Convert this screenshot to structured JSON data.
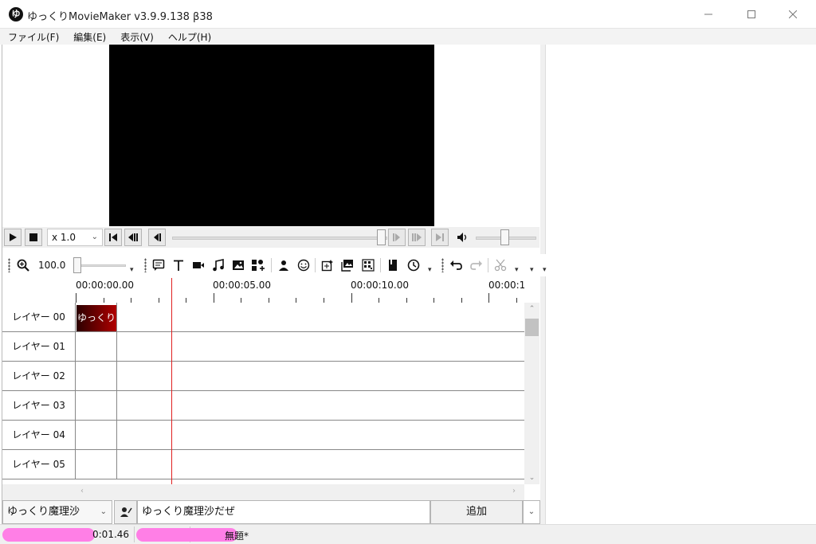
{
  "window": {
    "logo_char": "ゆ",
    "title": "ゆっくりMovieMaker v3.9.9.138 β38"
  },
  "menu": [
    "ファイル(F)",
    "編集(E)",
    "表示(V)",
    "ヘルプ(H)"
  ],
  "player": {
    "speed": "x 1.0"
  },
  "toolbar": {
    "zoom_value": "100.0"
  },
  "ruler": {
    "labels": [
      "00:00:00.00",
      "00:00:05.00",
      "00:00:10.00",
      "00:00:1"
    ]
  },
  "layers": [
    {
      "name": "レイヤー 00",
      "clip": "ゆっくり"
    },
    {
      "name": "レイヤー 01"
    },
    {
      "name": "レイヤー 02"
    },
    {
      "name": "レイヤー 03"
    },
    {
      "name": "レイヤー 04"
    },
    {
      "name": "レイヤー 05"
    }
  ],
  "talk": {
    "character": "ゆっくり魔理沙",
    "text": "ゆっくり魔理沙だぜ",
    "add_label": "追加"
  },
  "status": {
    "time": "0:01.46",
    "project_suffix": "無題*"
  },
  "colors": {
    "playhead": "#e02020",
    "clip": "#7a0000",
    "redaction": "#ff7fe6"
  }
}
